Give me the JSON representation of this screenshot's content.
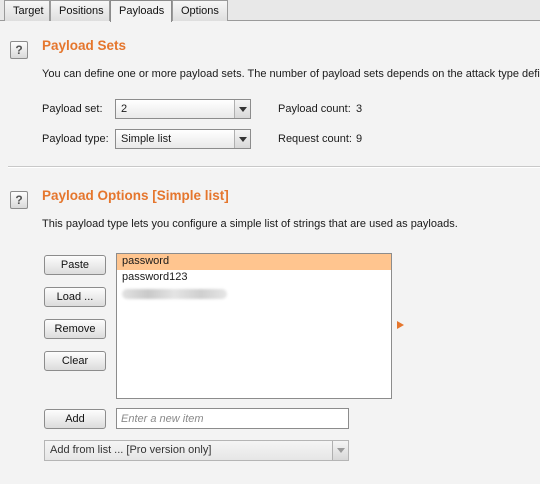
{
  "tabs": [
    {
      "label": "Target"
    },
    {
      "label": "Positions"
    },
    {
      "label": "Payloads"
    },
    {
      "label": "Options"
    }
  ],
  "active_tab": "Payloads",
  "payload_sets": {
    "help_glyph": "?",
    "title": "Payload Sets",
    "description": "You can define one or more payload sets. The number of payload sets depends on the attack type defi",
    "payload_set_label": "Payload set:",
    "payload_set_value": "2",
    "payload_type_label": "Payload type:",
    "payload_type_value": "Simple list",
    "payload_count_label": "Payload count:",
    "payload_count_value": "3",
    "request_count_label": "Request count:",
    "request_count_value": "9"
  },
  "payload_options": {
    "help_glyph": "?",
    "title": "Payload Options [Simple list]",
    "description": "This payload type lets you configure a simple list of strings that are used as payloads.",
    "buttons": {
      "paste": "Paste",
      "load": "Load ...",
      "remove": "Remove",
      "clear": "Clear",
      "add": "Add"
    },
    "list_items": [
      "password",
      "password123"
    ],
    "selected_index": 0,
    "add_placeholder": "Enter a new item",
    "add_from_list": "Add from list ... [Pro version only]"
  },
  "colors": {
    "accent": "#e5762d",
    "selection": "#ffc58f",
    "background": "#f3f3f3"
  }
}
